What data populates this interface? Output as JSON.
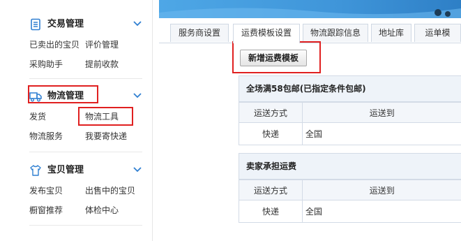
{
  "sidebar": {
    "sections": [
      {
        "title": "交易管理",
        "icon": "document-list-icon",
        "links": [
          "已卖出的宝贝",
          "评价管理",
          "采购助手",
          "提前收款"
        ]
      },
      {
        "title": "物流管理",
        "icon": "truck-icon",
        "links": [
          "发货",
          "物流工具",
          "物流服务",
          "我要寄快递"
        ]
      },
      {
        "title": "宝贝管理",
        "icon": "shirt-icon",
        "links": [
          "发布宝贝",
          "出售中的宝贝",
          "橱窗推荐",
          "体检中心"
        ]
      }
    ]
  },
  "tabs": [
    "服务商设置",
    "运费模板设置",
    "物流跟踪信息",
    "地址库",
    "运单模"
  ],
  "active_tab": "运费模板设置",
  "add_template_label": "新增运费模板",
  "templates": [
    {
      "title": "全场满58包邮(已指定条件包邮)",
      "columns": [
        "运送方式",
        "运送到"
      ],
      "rows": [
        [
          "快递",
          "全国"
        ]
      ]
    },
    {
      "title": "卖家承担运费",
      "columns": [
        "运送方式",
        "运送到"
      ],
      "rows": [
        [
          "快递",
          "全国"
        ]
      ]
    }
  ],
  "colors": {
    "highlight": "#e02020",
    "accent_blue": "#3f95d9"
  }
}
